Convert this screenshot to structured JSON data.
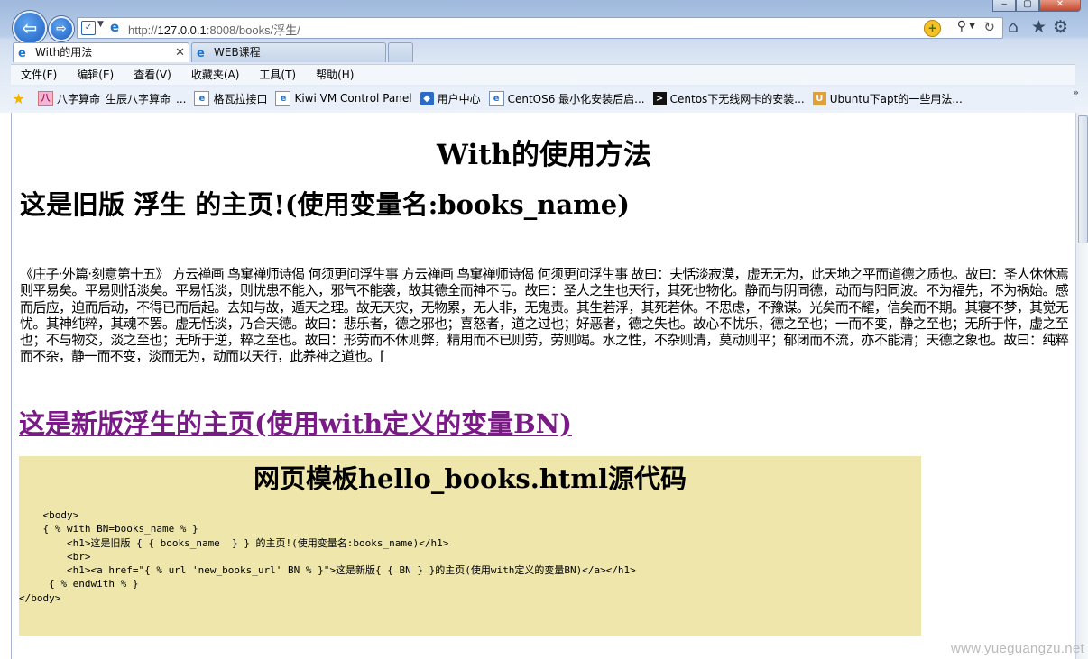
{
  "window": {
    "controls": [
      "‒",
      "▢",
      "✕"
    ]
  },
  "address_bar": {
    "url_prefix": "http://",
    "url_host": "127.0.0.1",
    "url_rest": ":8008/books/浮生/"
  },
  "tabs": [
    {
      "label": "With的用法",
      "active": true
    },
    {
      "label": "WEB课程",
      "active": false
    }
  ],
  "menu": [
    "文件(F)",
    "编辑(E)",
    "查看(V)",
    "收藏夹(A)",
    "工具(T)",
    "帮助(H)"
  ],
  "favorites": [
    {
      "label": "八字算命_生辰八字算命_...",
      "icon": "pink-page-icon"
    },
    {
      "label": "格瓦拉接口",
      "icon": "ie-page-icon"
    },
    {
      "label": "Kiwi VM Control Panel",
      "icon": "ie-page-icon"
    },
    {
      "label": "用户中心",
      "icon": "shield-page-icon"
    },
    {
      "label": "CentOS6 最小化安装后启...",
      "icon": "ie-page-icon"
    },
    {
      "label": "Centos下无线网卡的安装...",
      "icon": "terminal-icon"
    },
    {
      "label": "Ubuntu下apt的一些用法...",
      "icon": "ubuntu-icon"
    }
  ],
  "page": {
    "title": "With的使用方法",
    "heading_old": "这是旧版 浮生 的主页!(使用变量名:books_name)",
    "paragraph": "《庄子·外篇·刻意第十五》 方云禅画 鸟窠禅师诗偈 何须更问浮生事 方云禅画 鸟窠禅师诗偈 何须更问浮生事 故曰：夫恬淡寂漠，虚无无为，此天地之平而道德之质也。故曰：圣人休休焉则平易矣。平易则恬淡矣。平易恬淡，则忧患不能入，邪气不能袭，故其德全而神不亏。故曰：圣人之生也天行，其死也物化。静而与阴同德，动而与阳同波。不为福先，不为祸始。感而后应，迫而后动，不得已而后起。去知与故，遁天之理。故无天灾，无物累，无人非，无鬼责。其生若浮，其死若休。不思虑，不豫谋。光矣而不耀，信矣而不期。其寝不梦，其觉无忧。其神纯粹，其魂不罢。虚无恬淡，乃合天德。故曰：悲乐者，德之邪也；喜怒者，道之过也；好恶者，德之失也。故心不忧乐，德之至也；一而不变，静之至也；无所于忤，虚之至也；不与物交，淡之至也；无所于逆，粹之至也。故曰：形劳而不休则弊，精用而不已则劳，劳则竭。水之性，不杂则清，莫动则平；郁闭而不流，亦不能清；天德之象也。故曰：纯粹而不杂，静一而不变，淡而无为，动而以天行，此养神之道也。[",
    "link_new": "这是新版浮生的主页(使用with定义的变量BN)",
    "code_title": "网页模板hello_books.html源代码",
    "code": "    <body>\n    { % with BN=books_name % }\n        <h1>这是旧版 { { books_name  } } 的主页!(使用变量名:books_name)</h1>\n        <br>\n        <h1><a href=\"{ % url 'new_books_url' BN % }\">这是新版{ { BN } }的主页(使用with定义的变量BN)</a></h1>\n     { % endwith % }\n</body>"
  },
  "watermark": "www.yueguangzu.net",
  "colors": {
    "link": "#7a1a86",
    "code_background": "#eee6aa",
    "chrome_blue": "#b8cde9"
  }
}
